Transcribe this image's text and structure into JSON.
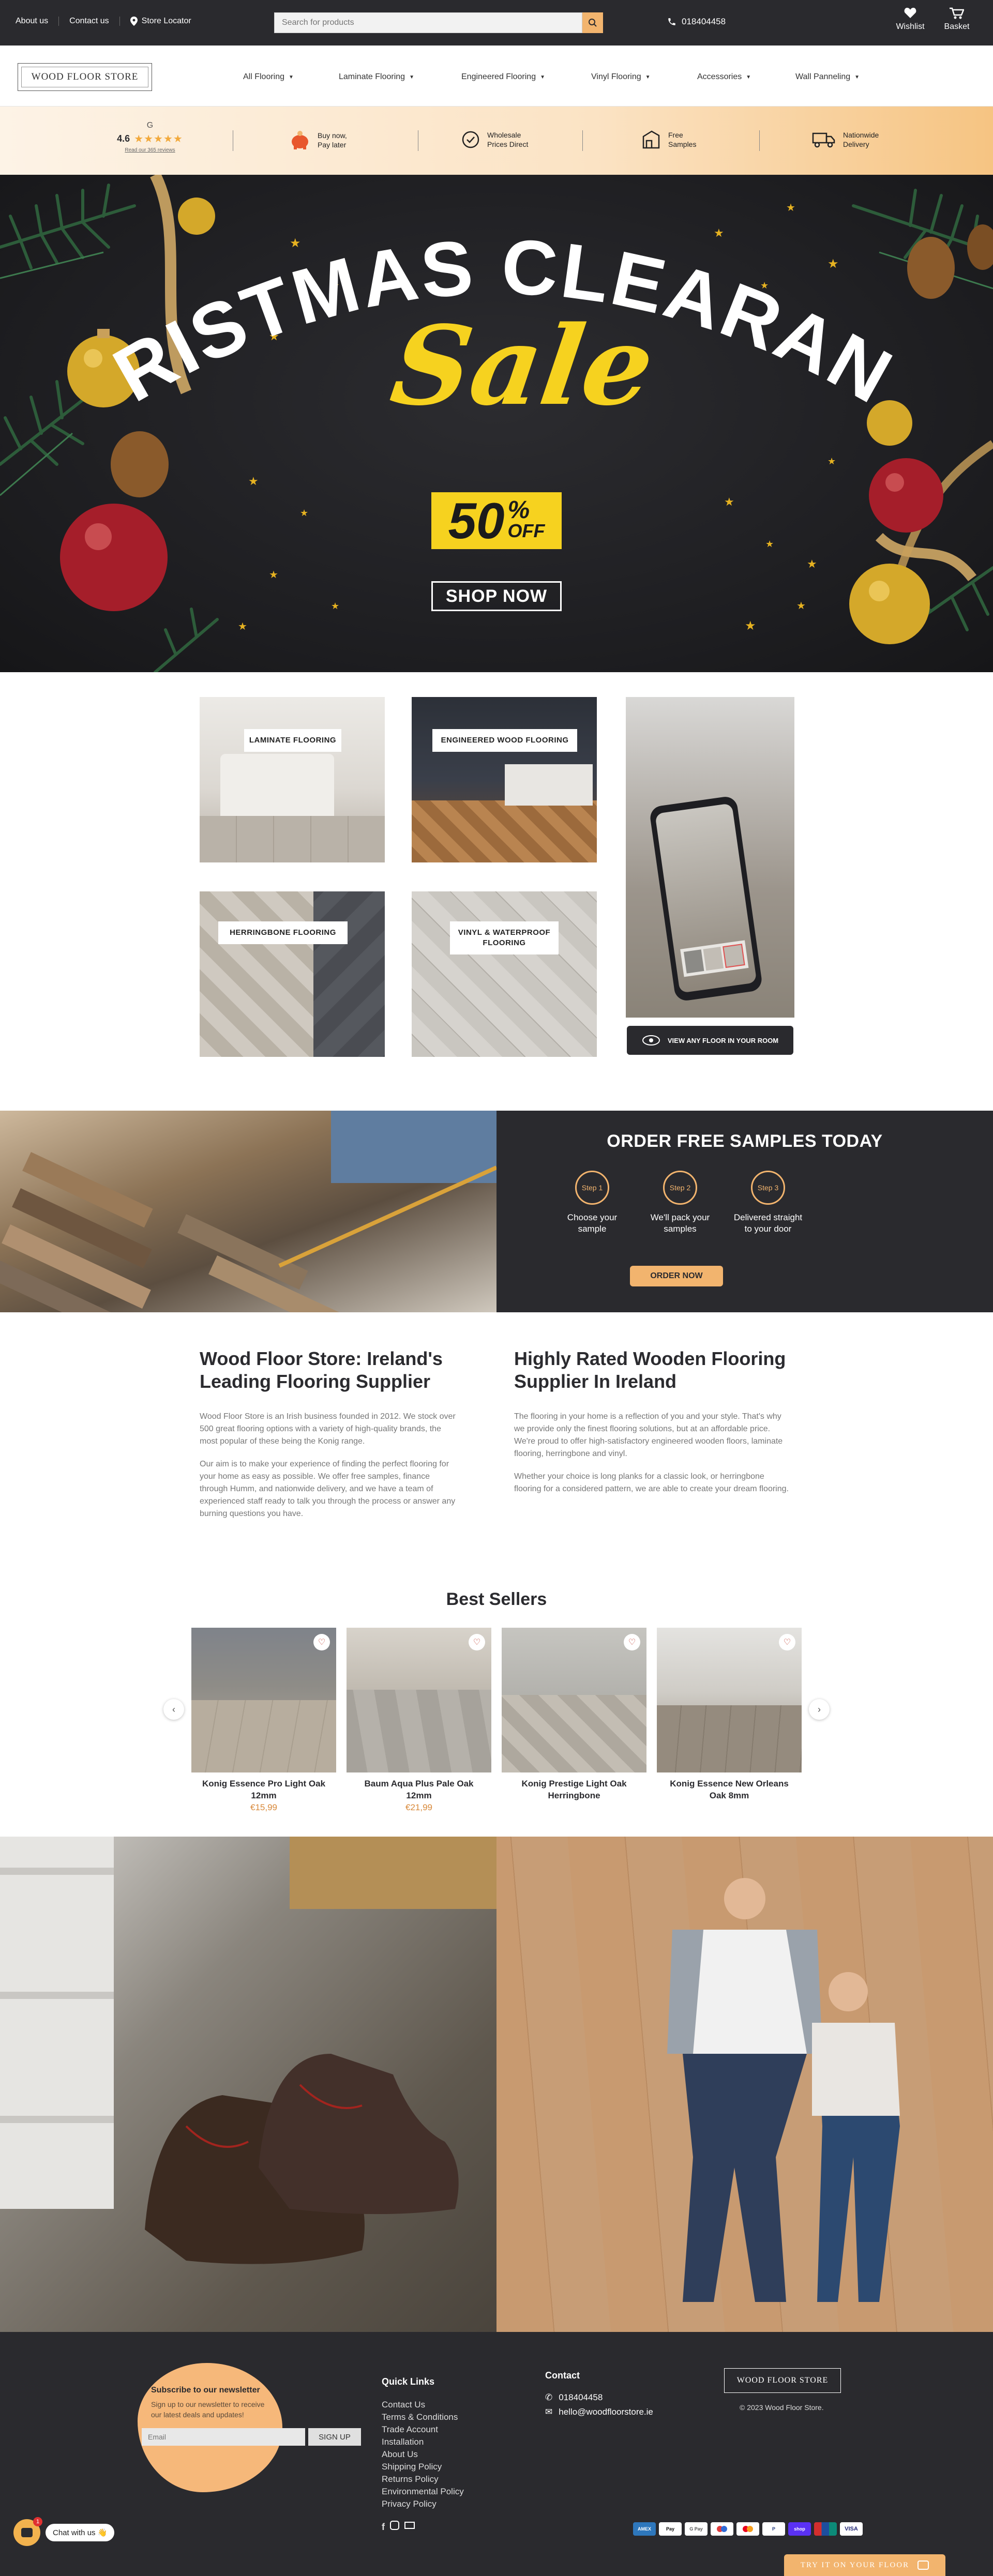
{
  "topbar": {
    "about": "About us",
    "contact": "Contact us",
    "store_locator": "Store Locator",
    "search_placeholder": "Search for products",
    "phone": "018404458",
    "wishlist": "Wishlist",
    "basket": "Basket"
  },
  "nav": {
    "logo": "WOOD FLOOR STORE",
    "items": [
      "All Flooring",
      "Laminate Flooring",
      "Engineered Flooring",
      "Vinyl Flooring",
      "Accessories",
      "Wall Panneling"
    ]
  },
  "usp": {
    "rating_g": "G",
    "rating": "4.6",
    "stars": "★★★★★",
    "reviews_link": "Read our 365 reviews",
    "items": [
      {
        "icon": "piggy-bank-icon",
        "line1": "Buy now,",
        "line2": "Pay later"
      },
      {
        "icon": "check-circle-icon",
        "line1": "Wholesale",
        "line2": "Prices Direct"
      },
      {
        "icon": "sample-box-icon",
        "line1": "Free",
        "line2": "Samples"
      },
      {
        "icon": "truck-icon",
        "line1": "Nationwide",
        "line2": "Delivery"
      }
    ]
  },
  "hero": {
    "title": "CHRISTMAS CLEARANCE",
    "script": "Sale",
    "percent": "50",
    "percent_sign": "%",
    "off": "OFF",
    "cta": "SHOP NOW"
  },
  "categories": {
    "laminate": "LAMINATE FLOORING",
    "engineered": "ENGINEERED WOOD FLOORING",
    "herringbone": "HERRINGBONE FLOORING",
    "vinyl_line1": "VINYL & WATERPROOF",
    "vinyl_line2": "FLOORING",
    "ar_cta": "VIEW ANY FLOOR IN YOUR ROOM"
  },
  "samples": {
    "title": "ORDER FREE SAMPLES TODAY",
    "steps": [
      {
        "badge": "Step 1",
        "line1": "Choose your",
        "line2": "sample"
      },
      {
        "badge": "Step 2",
        "line1": "We'll pack your",
        "line2": "samples"
      },
      {
        "badge": "Step 3",
        "line1": "Delivered straight",
        "line2": "to your door"
      }
    ],
    "cta": "ORDER NOW"
  },
  "about": {
    "left_title_1": "Wood Floor Store: Ireland's",
    "left_title_2": "Leading Flooring Supplier",
    "left_p1": "Wood Floor Store is an Irish business founded in 2012. We stock over 500 great flooring options with a variety of high-quality brands, the most popular of these being the Konig range.",
    "left_p2": "Our aim is to make your experience of finding the perfect flooring for your home as easy as possible. We offer free samples, finance through Humm, and nationwide delivery, and we have a team of experienced staff ready to talk you through the process or answer any burning questions you have.",
    "right_title_1": "Highly Rated Wooden Flooring",
    "right_title_2": "Supplier In Ireland",
    "right_p1": "The flooring in your home is a reflection of you and your style. That's why we provide only the finest flooring solutions, but at an affordable price. We're proud to offer high-satisfactory engineered wooden floors, laminate flooring, herringbone and vinyl.",
    "right_p2": "Whether your choice is long planks for a classic look, or herringbone flooring for a considered pattern, we are able to create your dream flooring."
  },
  "best_sellers": {
    "title": "Best Sellers",
    "products": [
      {
        "name1": "Konig Essence Pro Light Oak",
        "name2": "12mm",
        "price": "€15,99"
      },
      {
        "name1": "Baum Aqua Plus Pale Oak",
        "name2": "12mm",
        "price": "€21,99"
      },
      {
        "name1": "Konig Prestige Light Oak",
        "name2": "Herringbone",
        "price": ""
      },
      {
        "name1": "Konig Essence New Orleans",
        "name2": "Oak 8mm",
        "price": ""
      }
    ]
  },
  "footer": {
    "newsletter_title": "Subscribe to our newsletter",
    "newsletter_text_1": "Sign up to our newsletter to receive",
    "newsletter_text_2": "our latest deals and updates!",
    "email_placeholder": "Email",
    "signup": "SIGN UP",
    "quick_links_title": "Quick Links",
    "quick_links": [
      "Contact Us",
      "Terms & Conditions",
      "Trade Account",
      "Installation",
      "About Us",
      "Shipping Policy",
      "Returns Policy",
      "Environmental Policy",
      "Privacy Policy"
    ],
    "contact_title": "Contact",
    "phone": "018404458",
    "email": "hello@woodfloorstore.ie",
    "logo": "WOOD FLOOR STORE",
    "copyright": "© 2023 Wood Floor Store.",
    "payments": [
      "AMEX",
      "Pay",
      "G Pay",
      "",
      "",
      "P",
      "shop",
      "",
      "VISA"
    ],
    "chat": "Chat with us 👋",
    "chat_badge": "1",
    "try_floor": "TRY IT ON YOUR FLOOR"
  },
  "colors": {
    "accent": "#f2b46e",
    "dark": "#2a2a2e",
    "sale_yellow": "#f6d21f"
  }
}
